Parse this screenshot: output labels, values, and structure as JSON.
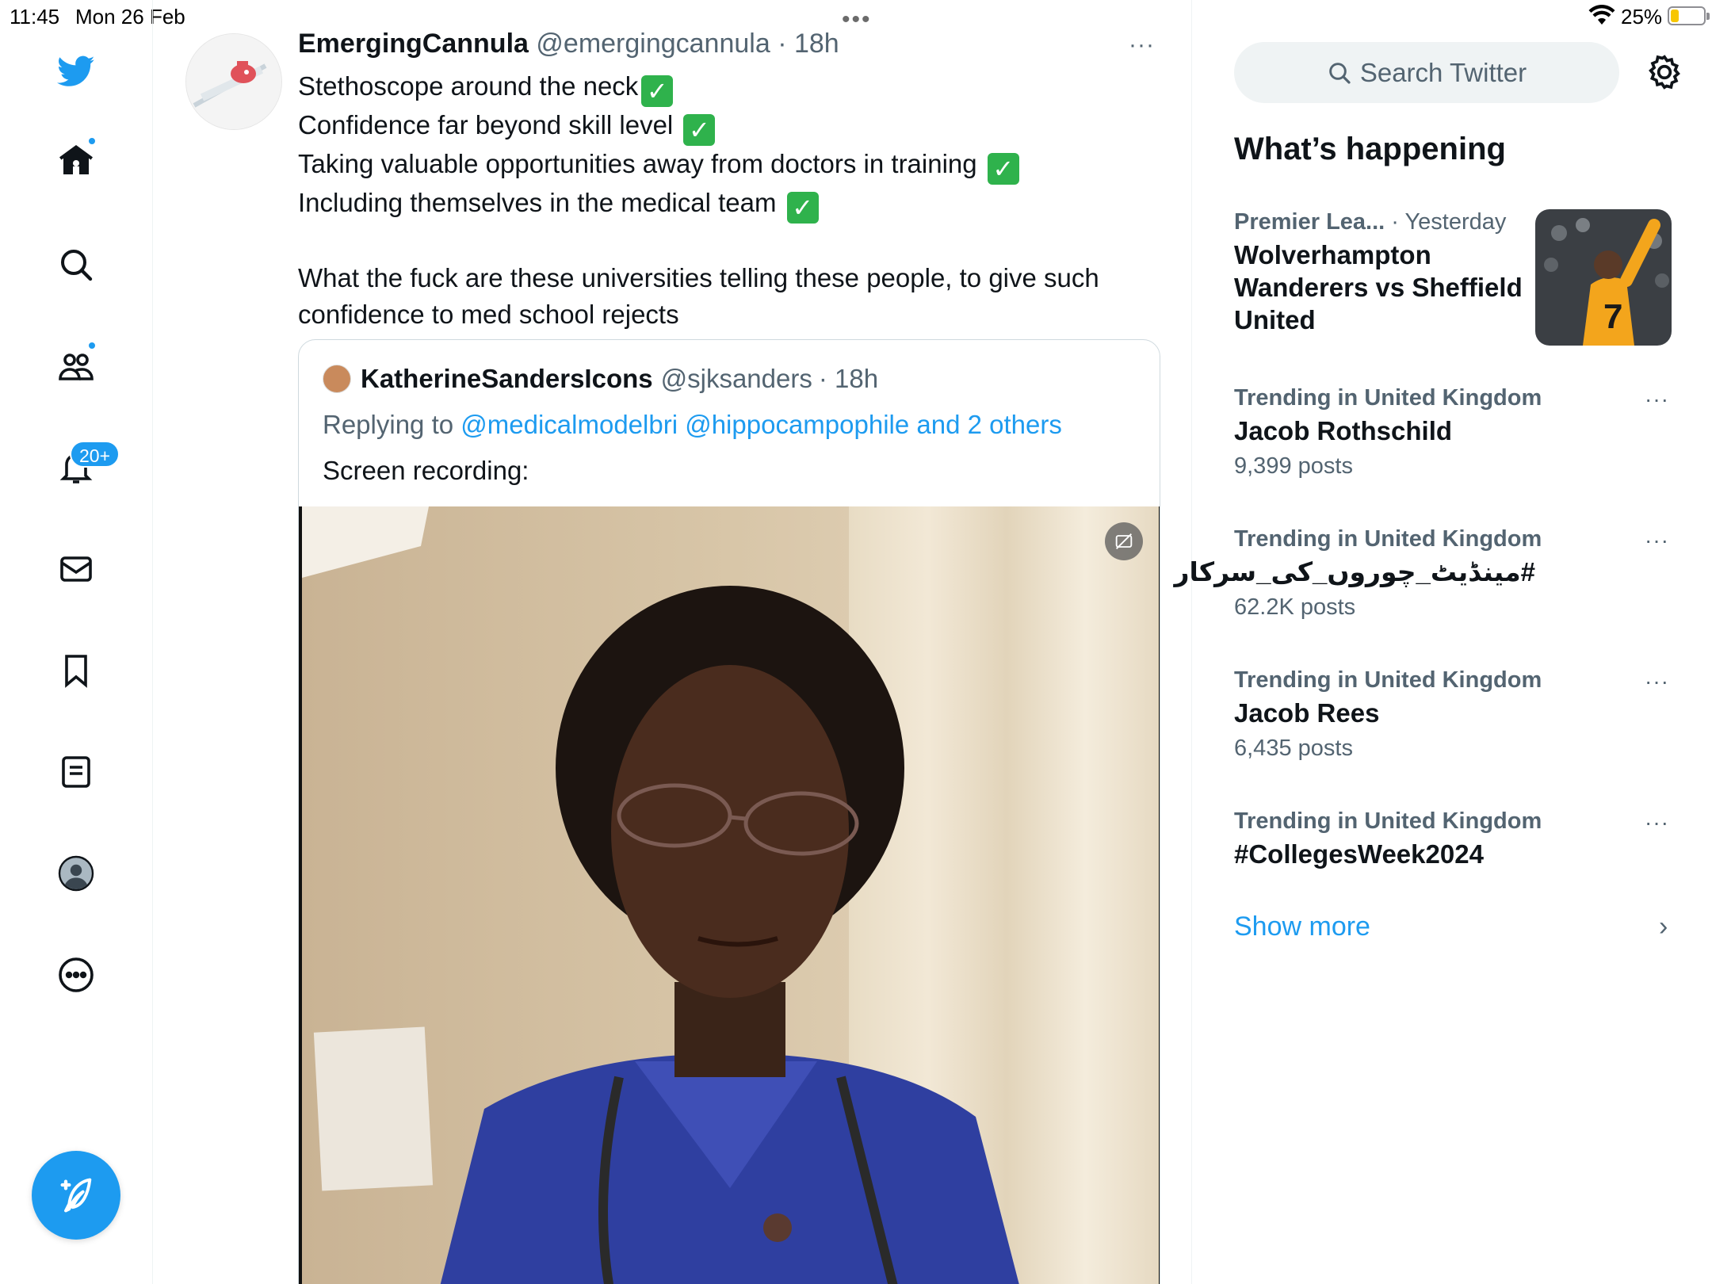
{
  "status_bar": {
    "time": "11:45",
    "date": "Mon 26 Feb",
    "battery_pct": "25%",
    "battery_level": 0.25,
    "battery_color": "#f7c600"
  },
  "nav": {
    "items": [
      {
        "name": "twitter-logo-icon"
      },
      {
        "name": "home-icon",
        "has_dot": true
      },
      {
        "name": "explore-search-icon"
      },
      {
        "name": "communities-icon",
        "has_dot": true
      },
      {
        "name": "notifications-bell-icon",
        "badge": "20+"
      },
      {
        "name": "messages-mail-icon"
      },
      {
        "name": "bookmarks-icon"
      },
      {
        "name": "lists-icon"
      },
      {
        "name": "profile-avatar-icon"
      },
      {
        "name": "more-options-icon"
      }
    ],
    "notifications_badge": "20+",
    "compose_icon": "compose-quill-icon",
    "accent_color": "#1d9bf0"
  },
  "tweet": {
    "author_name": "EmergingCannula",
    "author_handle": "@emergingcannula",
    "time": "· 18h",
    "more_icon": "···",
    "lines": [
      "Stethoscope around the neck",
      "Confidence far beyond skill level ",
      "Taking valuable opportunities away from doctors in training ",
      "Including themselves in the medical team "
    ],
    "check_emoji": "✓",
    "paragraph2": "What the fuck are these universities telling these people, to give such confidence to med school rejects",
    "quote": {
      "author_name": "KatherineSandersIcons",
      "author_handle": "@sjksanders",
      "time": "· 18h",
      "replying_prefix": "Replying to ",
      "replying_to_1": "@medicalmodelbri",
      "replying_to_2": "@hippocampophile",
      "replying_suffix": "and 2 others",
      "text": "Screen recording:"
    }
  },
  "sidebar": {
    "search_placeholder": "Search Twitter",
    "heading": "What’s happening",
    "featured": {
      "context": "Premier Lea...",
      "time": "· Yesterday",
      "title": "Wolverhampton Wanderers vs Sheffield United"
    },
    "trends": [
      {
        "context": "Trending in United Kingdom",
        "title": "Jacob Rothschild",
        "count": "9,399 posts"
      },
      {
        "context": "Trending in United Kingdom",
        "title": "#مینڈیٹ_چوروں_کی_سرکار",
        "count": "62.2K posts"
      },
      {
        "context": "Trending in United Kingdom",
        "title": "Jacob Rees",
        "count": "6,435 posts"
      },
      {
        "context": "Trending in United Kingdom",
        "title": "#CollegesWeek2024",
        "count": ""
      }
    ],
    "trend_more": "···",
    "show_more": "Show more",
    "show_more_chevron": "›"
  }
}
